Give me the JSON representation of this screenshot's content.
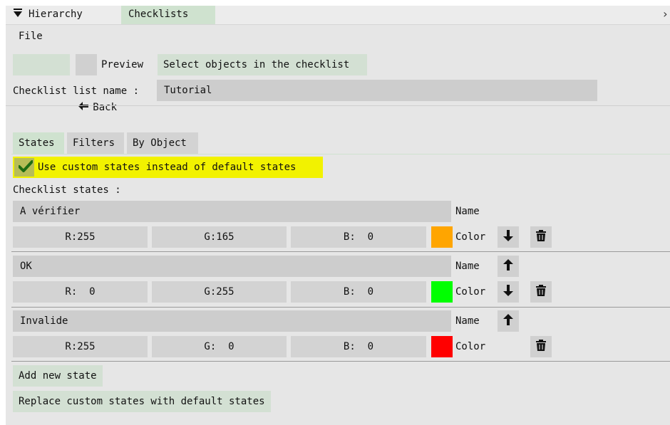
{
  "tabs": {
    "hierarchy": "Hierarchy",
    "checklists": "Checklists",
    "close": "›"
  },
  "menu": {
    "file": "File"
  },
  "toolbar": {
    "back_label": "Back",
    "preview_label": "Preview",
    "select_label": "Select objects in the checklist"
  },
  "list_name": {
    "label": "Checklist list name :",
    "value": "Tutorial"
  },
  "subtabs": [
    "States",
    "Filters",
    "By Object"
  ],
  "custom_states": {
    "label": "Use custom states instead of default states",
    "checked": true
  },
  "states_label": "Checklist states :",
  "states": [
    {
      "name": "A vérifier",
      "name_label": "Name",
      "r": "R:255",
      "g": "G:165",
      "b": "B:  0",
      "color": "#ffa500",
      "color_label": "Color"
    },
    {
      "name": "OK",
      "name_label": "Name",
      "r": "R:  0",
      "g": "G:255",
      "b": "B:  0",
      "color": "#00ff00",
      "color_label": "Color"
    },
    {
      "name": "Invalide",
      "name_label": "Name",
      "r": "R:255",
      "g": "G:  0",
      "b": "B:  0",
      "color": "#ff0000",
      "color_label": "Color"
    }
  ],
  "actions": {
    "add_state": "Add new state",
    "replace_states": "Replace custom states with default states"
  }
}
